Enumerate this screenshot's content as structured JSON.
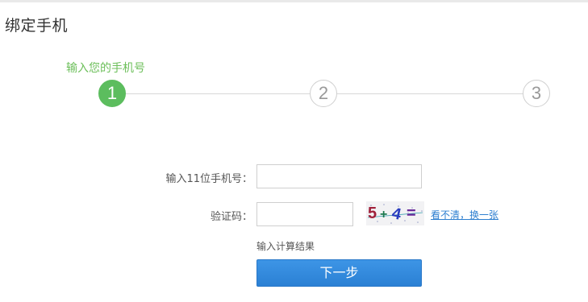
{
  "page": {
    "title": "绑定手机"
  },
  "steps": {
    "caption": "输入您的手机号",
    "items": [
      {
        "number": "1",
        "state": "active"
      },
      {
        "number": "2",
        "state": "pending"
      },
      {
        "number": "3",
        "state": "pending"
      }
    ],
    "active_color": "#5cbd5e"
  },
  "form": {
    "phone_label": "输入11位手机号：",
    "phone_value": "",
    "code_label": "验证码：",
    "code_value": "",
    "captcha_text": "5+4=",
    "refresh_link": "看不清，换一张",
    "hint": "输入计算结果",
    "next_button": "下一步"
  },
  "colors": {
    "primary_button": "#2b80d4",
    "link": "#2e7fd0"
  }
}
